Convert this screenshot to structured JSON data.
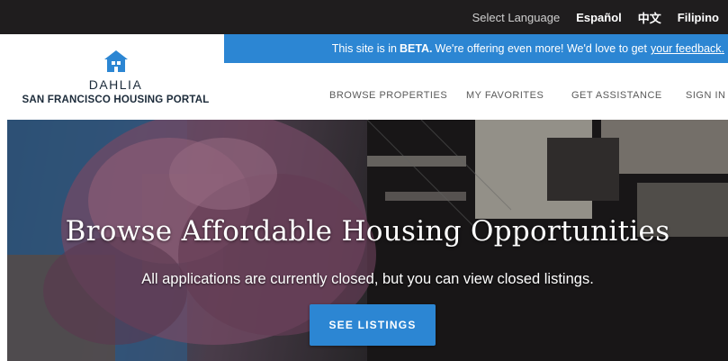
{
  "language_bar": {
    "label": "Select Language",
    "options": [
      "Español",
      "中文",
      "Filipino"
    ]
  },
  "beta_banner": {
    "prefix": "This site is in",
    "beta": "BETA.",
    "middle": "We're offering even more! We'd love to get",
    "link": "your feedback."
  },
  "logo": {
    "icon": "house-icon",
    "title": "DAHLIA",
    "subtitle": "SAN FRANCISCO HOUSING PORTAL"
  },
  "nav": {
    "browse": "BROWSE PROPERTIES",
    "favorites": "MY FAVORITES",
    "assistance": "GET ASSISTANCE",
    "signin": "SIGN IN"
  },
  "hero": {
    "title": "Browse Affordable Housing Opportunities",
    "subtitle": "All applications are currently closed, but you can view closed listings.",
    "cta": "SEE LISTINGS"
  },
  "colors": {
    "accent": "#2c86d3",
    "topbar": "#1f1d1e"
  }
}
